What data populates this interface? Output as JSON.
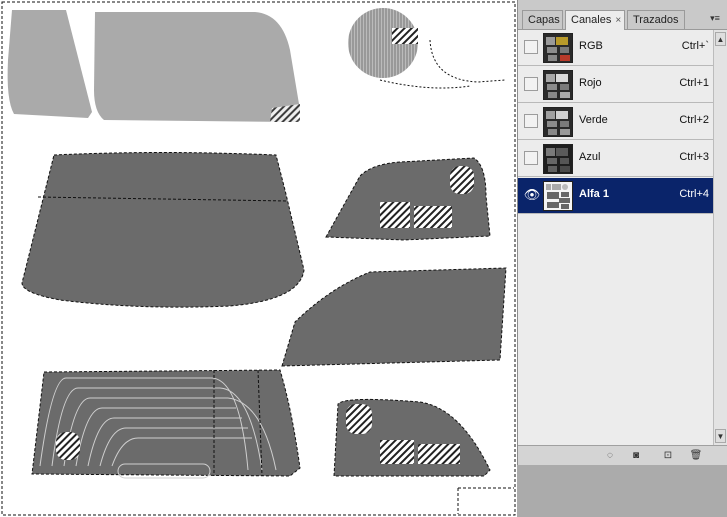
{
  "panel": {
    "tabs": [
      {
        "label": "Capas",
        "active": false
      },
      {
        "label": "Canales",
        "active": true,
        "close_glyph": "×"
      },
      {
        "label": "Trazados",
        "active": false
      }
    ],
    "menu_icon": "panel-menu-icon",
    "channels": [
      {
        "label": "RGB",
        "shortcut": "Ctrl+`",
        "visible": false,
        "selected": false,
        "thumb": "rgb"
      },
      {
        "label": "Rojo",
        "shortcut": "Ctrl+1",
        "visible": false,
        "selected": false,
        "thumb": "gray"
      },
      {
        "label": "Verde",
        "shortcut": "Ctrl+2",
        "visible": false,
        "selected": false,
        "thumb": "gray"
      },
      {
        "label": "Azul",
        "shortcut": "Ctrl+3",
        "visible": false,
        "selected": false,
        "thumb": "dark"
      },
      {
        "label": "Alfa 1",
        "shortcut": "Ctrl+4",
        "visible": true,
        "selected": true,
        "thumb": "alpha"
      }
    ],
    "footer_icons": [
      "load-selection-icon",
      "save-selection-mask-icon",
      "new-channel-icon",
      "delete-channel-icon"
    ],
    "footer_glyphs": [
      "◌",
      "◙",
      "⊡",
      "🗑"
    ],
    "selected_color": "#0a246a"
  }
}
